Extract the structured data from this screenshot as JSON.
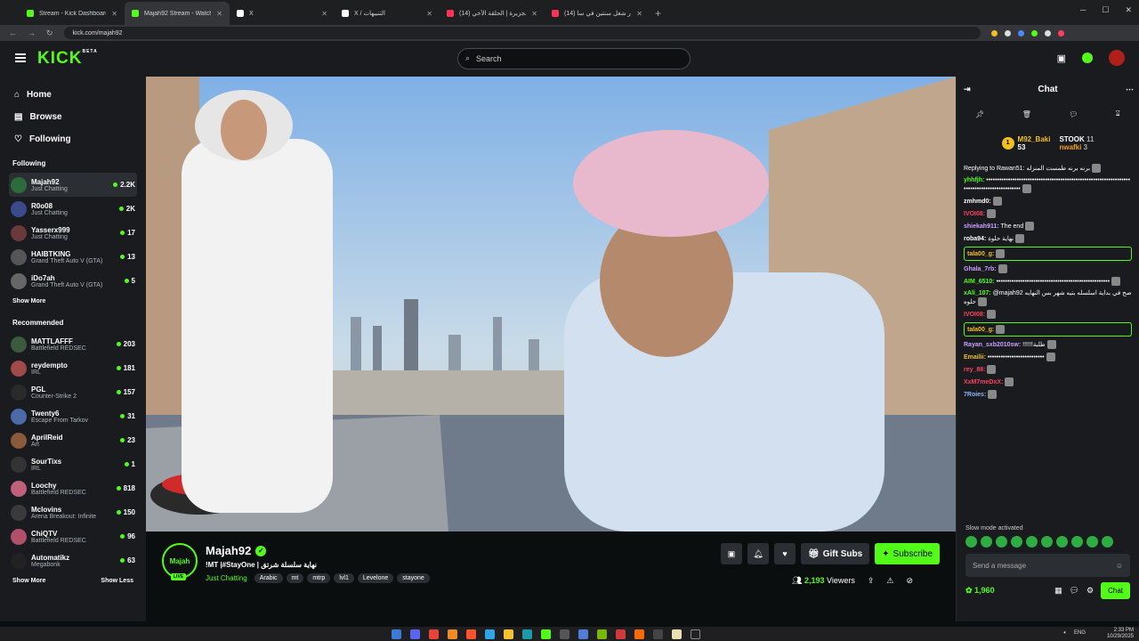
{
  "browser": {
    "tabs": [
      {
        "title": "Stream - Kick Dashboard",
        "color": "#53fc18",
        "active": false
      },
      {
        "title": "Majah92 Stream - Watch Li",
        "color": "#53fc18",
        "active": true
      },
      {
        "title": "X",
        "color": "#ffffff",
        "active": false
      },
      {
        "title": "X / التنبيهات",
        "color": "#ffffff",
        "active": false
      },
      {
        "title": "نهاية الجزيرة | الحلقة الأخي (14)",
        "color": "#ff3355",
        "active": false
      },
      {
        "title": "اختصار شغل سنتين في سا (14)",
        "color": "#ff3355",
        "active": false
      }
    ],
    "url": "kick.com/majah92"
  },
  "header": {
    "logo": "KICK",
    "logo_badge": "BETA",
    "search_placeholder": "Search"
  },
  "sidebar": {
    "nav": [
      {
        "label": "Home",
        "icon": "home-icon"
      },
      {
        "label": "Browse",
        "icon": "browse-icon"
      },
      {
        "label": "Following",
        "icon": "heart-icon"
      }
    ],
    "following_title": "Following",
    "following": [
      {
        "name": "Majah92",
        "category": "Just Chatting",
        "viewers": "2.2K"
      },
      {
        "name": "R0o08",
        "category": "Just Chatting",
        "viewers": "2K"
      },
      {
        "name": "Yasserx999",
        "category": "Just Chatting",
        "viewers": "17"
      },
      {
        "name": "HAIBTKING",
        "category": "Grand Theft Auto V (GTA)",
        "viewers": "13"
      },
      {
        "name": "iDo7ah",
        "category": "Grand Theft Auto V (GTA)",
        "viewers": "5"
      }
    ],
    "show_more": "Show More",
    "recommended_title": "Recommended",
    "recommended": [
      {
        "name": "MATTLAFFF",
        "category": "Battlefield REDSEC",
        "viewers": "203"
      },
      {
        "name": "reydempto",
        "category": "IRL",
        "viewers": "181"
      },
      {
        "name": "PGL",
        "category": "Counter-Strike 2",
        "viewers": "157"
      },
      {
        "name": "Twenty6",
        "category": "Escape From Tarkov",
        "viewers": "31"
      },
      {
        "name": "AprilReid",
        "category": "Art",
        "viewers": "23"
      },
      {
        "name": "SourTixs",
        "category": "IRL",
        "viewers": "1"
      },
      {
        "name": "Loochy",
        "category": "Battlefield REDSEC",
        "viewers": "818"
      },
      {
        "name": "Mclovins",
        "category": "Arena Breakout: Infinite",
        "viewers": "150"
      },
      {
        "name": "ChiQTV",
        "category": "Battlefield REDSEC",
        "viewers": "96"
      },
      {
        "name": "Automatikz",
        "category": "Megabonk",
        "viewers": "63"
      }
    ],
    "show_more_2": "Show More",
    "show_less": "Show Less"
  },
  "stream": {
    "avatar_text": "Majah",
    "live_label": "LIVE",
    "streamer": "Majah92",
    "title": "!MT |#StayOne | نهاية سلسلة شرتق",
    "category": "Just Chatting",
    "tags": [
      "Arabic",
      "mt",
      "mtrp",
      "lvl1",
      "Levelone",
      "stayone"
    ],
    "gift_label": "Gift Subs",
    "subscribe_label": "Subscribe",
    "viewers": "2,193",
    "viewers_label": "Viewers"
  },
  "chat": {
    "title": "Chat",
    "leaderboard": [
      {
        "name": "M92_Baki",
        "count": "53"
      },
      {
        "name": "STOOK",
        "count": "11"
      },
      {
        "name": "nwafki",
        "count": "3"
      }
    ],
    "messages": [
      {
        "user": "",
        "text": "Replying to Rawan51: برنه برنه طمست المنزله",
        "color": "#aaaaaa"
      },
      {
        "user": "yhhfjh:",
        "text": "••••••••••••••••••••••••••••••••••••••••••••••••••••••••••••••••••••••••••••••••••••••••••••",
        "color": "#53fc18"
      },
      {
        "user": "zmhmd0:",
        "text": "",
        "color": "#ffffff"
      },
      {
        "user": "IVOI08:",
        "text": "",
        "color": "#ff4060"
      },
      {
        "user": "shiekah911:",
        "text": "The end",
        "color": "#c9a0ff"
      },
      {
        "user": "roba94:",
        "text": "نهاية حلوة",
        "color": "#ffffff"
      },
      {
        "user": "tala00_g:",
        "text": "",
        "color": "#f0c020"
      },
      {
        "user": "Ghala_7rb:",
        "text": "",
        "color": "#c9a0ff"
      },
      {
        "user": "AIM_6510:",
        "text": "••••••••••••••••••••••••••••••••••••••••••••••••••••",
        "color": "#53fc18"
      },
      {
        "user": "xAli_107:",
        "text": "@majah92 صح في بداية اسلسله بتيه شهر بس النهايه حلوه",
        "color": "#53fc18"
      },
      {
        "user": "IVOI08:",
        "text": "",
        "color": "#ff4060"
      },
      {
        "user": "tala00_g:",
        "text": "",
        "color": "#f0c020"
      },
      {
        "user": "Rayan_sxb2010sw:",
        "text": "!!!!!!طلبة",
        "color": "#c9a0ff"
      },
      {
        "user": "Emailii:",
        "text": "••••••••••••••••••••••••••",
        "color": "#f0c020"
      },
      {
        "user": "rey_88:",
        "text": "",
        "color": "#ff4060"
      },
      {
        "user": "XxM7meDxX:",
        "text": "",
        "color": "#ff4060"
      },
      {
        "user": "7Roies:",
        "text": "",
        "color": "#8ab4ff"
      }
    ],
    "slow_mode": "Slow mode activated",
    "send_placeholder": "Send a message",
    "points": "1,960",
    "chat_button": "Chat"
  },
  "taskbar": {
    "lang": "ENG",
    "time": "2:33 PM",
    "date": "10/29/2025"
  }
}
